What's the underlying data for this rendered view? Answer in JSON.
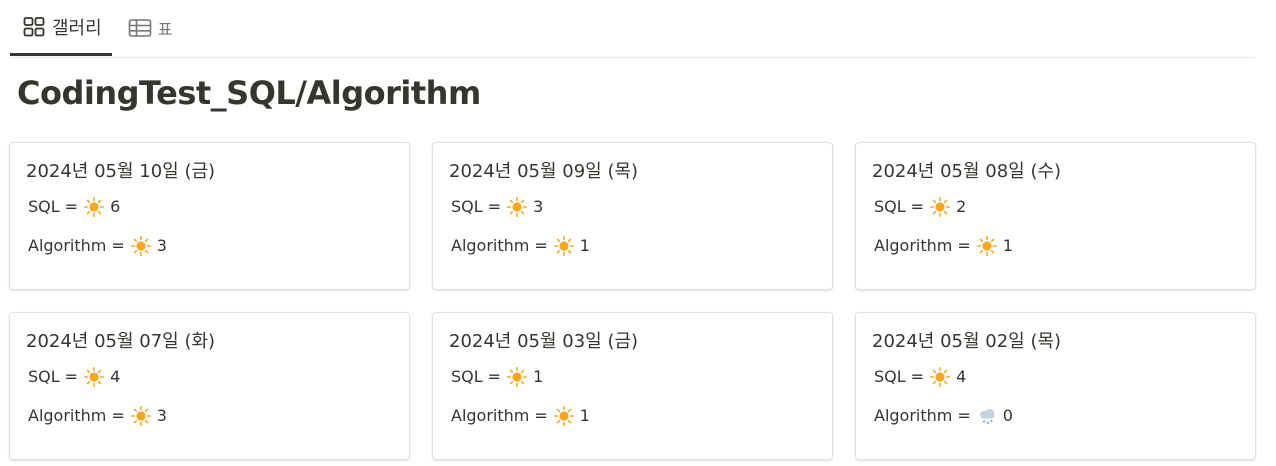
{
  "tabs": [
    {
      "label": "갤러리",
      "icon": "gallery-grid-icon",
      "active": true
    },
    {
      "label": "표",
      "icon": "table-icon",
      "active": false
    }
  ],
  "page": {
    "title": "CodingTest_SQL/Algorithm"
  },
  "cards": [
    {
      "date": "2024년 05월 10일 (금)",
      "sql_label": "SQL",
      "sql_eq": "=",
      "sql_icon": "sun-icon",
      "sql_value": "6",
      "algo_label": "Algorithm",
      "algo_eq": "=",
      "algo_icon": "sun-icon",
      "algo_value": "3"
    },
    {
      "date": "2024년 05월 09일 (목)",
      "sql_label": "SQL",
      "sql_eq": "=",
      "sql_icon": "sun-icon",
      "sql_value": "3",
      "algo_label": "Algorithm",
      "algo_eq": "=",
      "algo_icon": "sun-icon",
      "algo_value": "1"
    },
    {
      "date": "2024년 05월 08일 (수)",
      "sql_label": "SQL",
      "sql_eq": "=",
      "sql_icon": "sun-icon",
      "sql_value": "2",
      "algo_label": "Algorithm",
      "algo_eq": "=",
      "algo_icon": "sun-icon",
      "algo_value": "1"
    },
    {
      "date": "2024년 05월 07일 (화)",
      "sql_label": "SQL",
      "sql_eq": "=",
      "sql_icon": "sun-icon",
      "sql_value": "4",
      "algo_label": "Algorithm",
      "algo_eq": "=",
      "algo_icon": "sun-icon",
      "algo_value": "3"
    },
    {
      "date": "2024년 05월 03일 (금)",
      "sql_label": "SQL",
      "sql_eq": "=",
      "sql_icon": "sun-icon",
      "sql_value": "1",
      "algo_label": "Algorithm",
      "algo_eq": "=",
      "algo_icon": "sun-icon",
      "algo_value": "1"
    },
    {
      "date": "2024년 05월 02일 (목)",
      "sql_label": "SQL",
      "sql_eq": "=",
      "sql_icon": "sun-icon",
      "sql_value": "4",
      "algo_label": "Algorithm",
      "algo_eq": "=",
      "algo_icon": "snow-cloud-icon",
      "algo_value": "0"
    }
  ],
  "colors": {
    "text": "#37352f",
    "muted": "#787774",
    "sun": "#f5a623",
    "cloud": "#c7d3df",
    "snow": "#7aa7d6"
  }
}
